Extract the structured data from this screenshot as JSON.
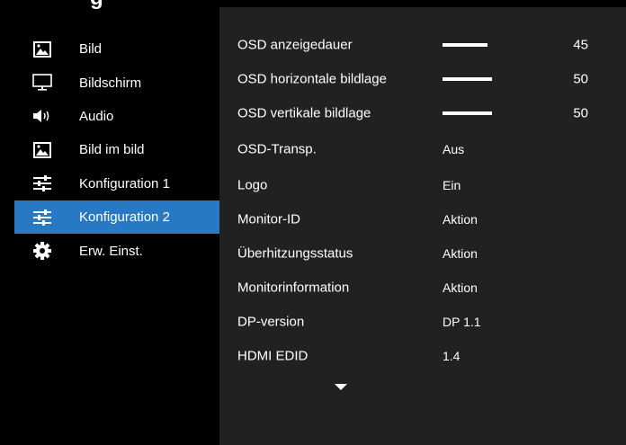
{
  "header": {
    "title_fragment": "g"
  },
  "sidebar": {
    "items": [
      {
        "label": "Bild",
        "icon": "picture-icon",
        "selected": false
      },
      {
        "label": "Bildschirm",
        "icon": "monitor-icon",
        "selected": false
      },
      {
        "label": "Audio",
        "icon": "speaker-icon",
        "selected": false
      },
      {
        "label": "Bild im bild",
        "icon": "picture-in-picture-icon",
        "selected": false
      },
      {
        "label": "Konfiguration 1",
        "icon": "sliders-icon",
        "selected": false
      },
      {
        "label": "Konfiguration 2",
        "icon": "sliders-icon",
        "selected": true
      },
      {
        "label": "Erw. Einst.",
        "icon": "gear-icon",
        "selected": false
      }
    ]
  },
  "settings": {
    "rows": [
      {
        "label": "OSD anzeigedauer",
        "type": "slider",
        "value": 45,
        "fill_fraction": 0.45
      },
      {
        "label": "OSD horizontale bildlage",
        "type": "slider",
        "value": 50,
        "fill_fraction": 0.5
      },
      {
        "label": "OSD vertikale bildlage",
        "type": "slider",
        "value": 50,
        "fill_fraction": 0.5
      },
      {
        "label": "OSD-Transp.",
        "type": "value",
        "value": "Aus"
      },
      {
        "label": "Logo",
        "type": "value",
        "value": "Ein"
      },
      {
        "label": "Monitor-ID",
        "type": "value",
        "value": "Aktion"
      },
      {
        "label": "Überhitzungsstatus",
        "type": "value",
        "value": "Aktion"
      },
      {
        "label": "Monitorinformation",
        "type": "value",
        "value": "Aktion"
      },
      {
        "label": "DP-version",
        "type": "value",
        "value": "DP 1.1"
      },
      {
        "label": "HDMI EDID",
        "type": "value",
        "value": "1.4"
      }
    ],
    "more_indicator": "chevron-down-icon"
  },
  "colors": {
    "accent": "#2679c2",
    "panel": "#212121",
    "background": "#000000"
  }
}
